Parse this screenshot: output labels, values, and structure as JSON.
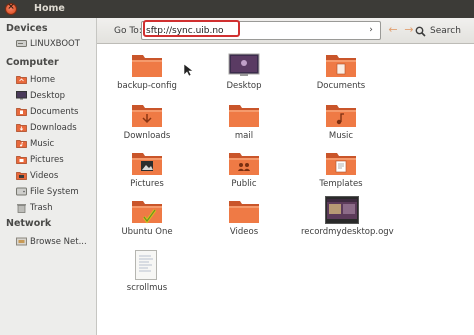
{
  "window": {
    "title": "Home",
    "close_glyph": "×"
  },
  "sidebar": {
    "devices_heading": "Devices",
    "devices": [
      {
        "label": "LINUXBOOT",
        "icon": "drive-icon"
      }
    ],
    "computer_heading": "Computer",
    "computer": [
      {
        "label": "Home",
        "icon": "home-folder-icon"
      },
      {
        "label": "Desktop",
        "icon": "desktop-icon"
      },
      {
        "label": "Documents",
        "icon": "documents-icon"
      },
      {
        "label": "Downloads",
        "icon": "downloads-icon"
      },
      {
        "label": "Music",
        "icon": "music-icon"
      },
      {
        "label": "Pictures",
        "icon": "pictures-icon"
      },
      {
        "label": "Videos",
        "icon": "videos-icon"
      },
      {
        "label": "File System",
        "icon": "filesystem-icon"
      },
      {
        "label": "Trash",
        "icon": "trash-icon"
      }
    ],
    "network_heading": "Network",
    "network": [
      {
        "label": "Browse Net...",
        "icon": "network-icon"
      }
    ]
  },
  "toolbar": {
    "goto_label": "Go To:",
    "location_value": "sftp://sync.uib.no",
    "go_glyph": "›",
    "back_glyph": "←",
    "forward_glyph": "→",
    "search_label": "Search"
  },
  "files": [
    {
      "label": "backup-config",
      "icon": "folder-icon"
    },
    {
      "label": "Desktop",
      "icon": "desktop-folder-icon"
    },
    {
      "label": "Documents",
      "icon": "documents-folder-icon"
    },
    {
      "label": "Downloads",
      "icon": "downloads-folder-icon"
    },
    {
      "label": "mail",
      "icon": "folder-icon"
    },
    {
      "label": "Music",
      "icon": "music-folder-icon"
    },
    {
      "label": "Pictures",
      "icon": "pictures-folder-icon"
    },
    {
      "label": "Public",
      "icon": "public-folder-icon"
    },
    {
      "label": "Templates",
      "icon": "templates-folder-icon"
    },
    {
      "label": "Ubuntu One",
      "icon": "ubuntu-one-folder-icon"
    },
    {
      "label": "Videos",
      "icon": "videos-folder-icon"
    },
    {
      "label": "recordmydesktop.ogv",
      "icon": "video-file-icon"
    },
    {
      "label": "scrollmus",
      "icon": "text-file-icon"
    }
  ],
  "colors": {
    "titlebar": "#3c3b37",
    "folder_orange": "#e8693c",
    "highlight_red": "#d03030",
    "sidebar_bg": "#ededeb"
  }
}
